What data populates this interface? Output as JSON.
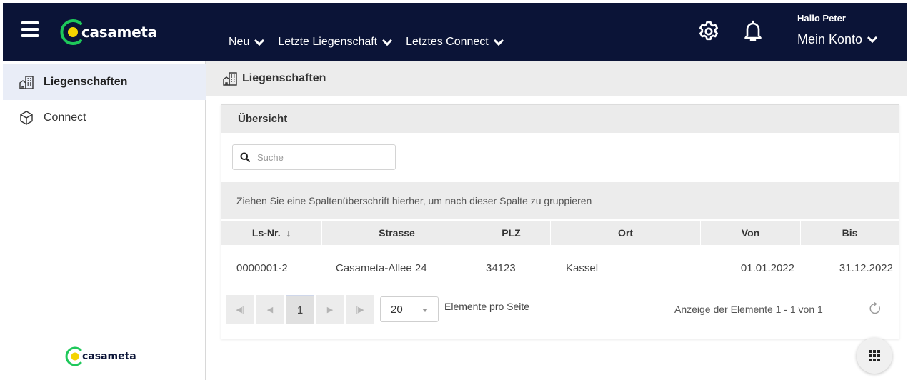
{
  "header": {
    "brand": "casameta",
    "nav": [
      {
        "label": "Neu"
      },
      {
        "label": "Letzte Liegenschaft"
      },
      {
        "label": "Letztes Connect"
      }
    ],
    "greeting": "Hallo Peter",
    "account_label": "Mein Konto",
    "icons": [
      "menu-icon",
      "gear-icon",
      "bell-icon",
      "chevron-down-icon"
    ]
  },
  "sidebar": {
    "items": [
      {
        "label": "Liegenschaften",
        "icon": "buildings-icon",
        "active": true
      },
      {
        "label": "Connect",
        "icon": "cube-icon",
        "active": false
      }
    ],
    "footer_brand": "casameta"
  },
  "main": {
    "breadcrumb": "Liegenschaften",
    "panel_title": "Übersicht",
    "search": {
      "placeholder": "Suche",
      "value": ""
    },
    "group_hint": "Ziehen Sie eine Spaltenüberschrift hierher, um nach dieser Spalte zu gruppieren",
    "columns": [
      "Ls-Nr.",
      "Strasse",
      "PLZ",
      "Ort",
      "Von",
      "Bis"
    ],
    "sort": {
      "column": "Ls-Nr.",
      "indicator": "↓"
    },
    "rows": [
      [
        "0000001-2",
        "Casameta-Allee 24",
        "34123",
        "Kassel",
        "01.01.2022",
        "31.12.2022"
      ]
    ],
    "pager": {
      "current_page": "1",
      "page_size": "20",
      "page_size_label": "Elemente pro Seite",
      "info": "Anzeige der Elemente 1 - 1 von 1"
    }
  },
  "colors": {
    "topbar": "#0b1437",
    "accent_green": "#1ec85a",
    "accent_yellow": "#f4d400",
    "active_item_bg": "#e9edf7"
  }
}
